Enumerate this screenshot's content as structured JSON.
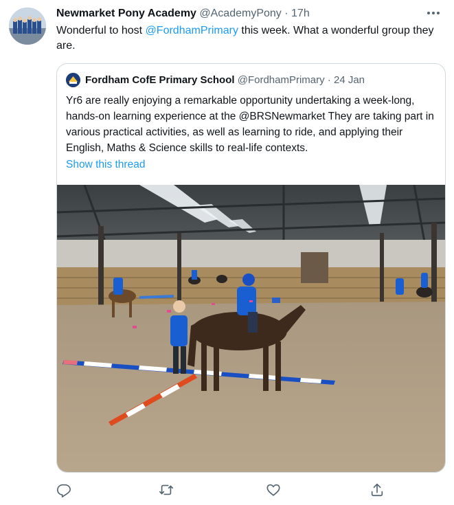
{
  "tweet": {
    "author_name": "Newmarket Pony Academy",
    "author_handle": "@AcademyPony",
    "separator": "·",
    "time": "17h",
    "text_before": "Wonderful to host ",
    "mention": "@FordhamPrimary",
    "text_after": " this week. What a wonderful group they are."
  },
  "quote": {
    "author_name": "Fordham CofE Primary School",
    "author_handle": "@FordhamPrimary",
    "separator": "·",
    "date": "24 Jan",
    "text": "Yr6 are really enjoying a remarkable opportunity undertaking a week-long, hands-on learning experience at the @BRSNewmarket They are taking part in various practical activities, as well as learning to ride, and applying their English, Maths & Science skills to real-life contexts.",
    "show_thread": "Show this thread"
  },
  "actions": [
    "reply-icon",
    "retweet-icon",
    "like-icon",
    "share-icon"
  ],
  "colors": {
    "link": "#1d9bf0",
    "muted": "#536471",
    "border": "#cfd9de",
    "text": "#0f1419"
  }
}
